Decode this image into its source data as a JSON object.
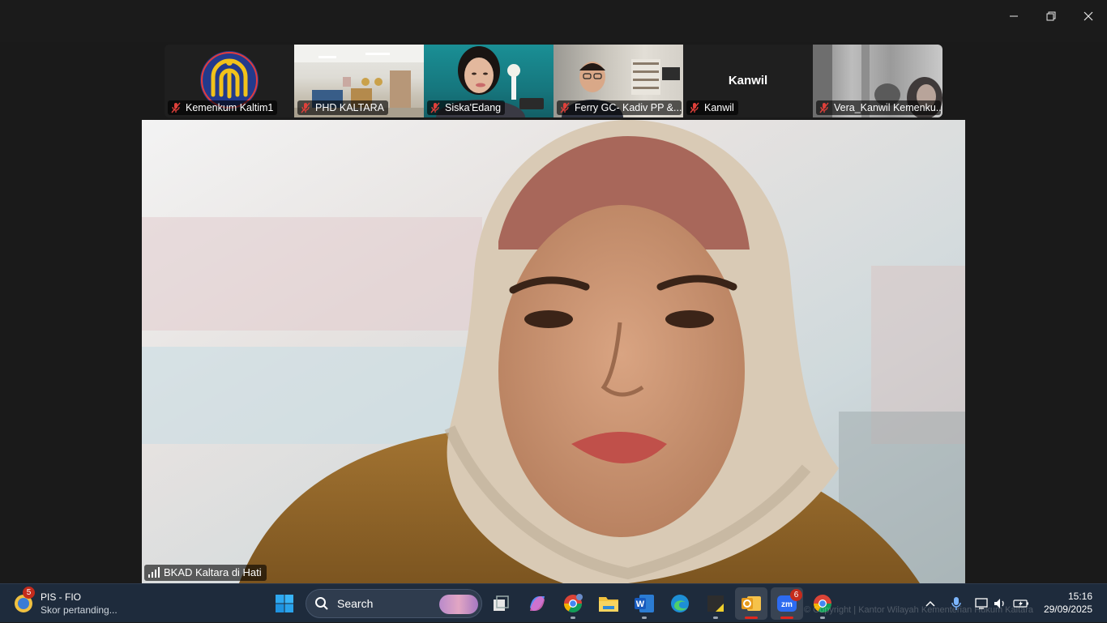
{
  "window": {
    "controls": [
      "minimize-icon",
      "restore-icon",
      "close-icon"
    ]
  },
  "participants": [
    {
      "name": "Kemenkum Kaltim1",
      "muted": true,
      "kind": "logo"
    },
    {
      "name": "PHD KALTARA",
      "muted": true,
      "kind": "video"
    },
    {
      "name": "Siska'Edang",
      "muted": true,
      "kind": "video"
    },
    {
      "name": "Ferry GC- Kadiv PP &...",
      "muted": true,
      "kind": "video"
    },
    {
      "name": "Kanwil",
      "display_name": "Kanwil",
      "muted": true,
      "kind": "name-only"
    },
    {
      "name": "Vera_Kanwil Kemenku...",
      "muted": true,
      "kind": "video"
    }
  ],
  "active_speaker": {
    "name": "BKAD Kaltara di Hati"
  },
  "taskbar": {
    "widget": {
      "badge": "5",
      "title": "PIS - FIO",
      "subtitle": "Skor pertanding..."
    },
    "search_placeholder": "Search",
    "zoom_badge": "6",
    "watermark": "© Copyright | Kantor Wilayah Kementerian Hukum Kaltara",
    "time": "15:16",
    "date": "29/09/2025"
  },
  "colors": {
    "taskbar_bg": "#1e2b3c",
    "stage_bg": "#1a1a1a",
    "mute_red": "#e0403a",
    "logo_blue": "#233a8c",
    "logo_gold": "#f2c21a"
  }
}
